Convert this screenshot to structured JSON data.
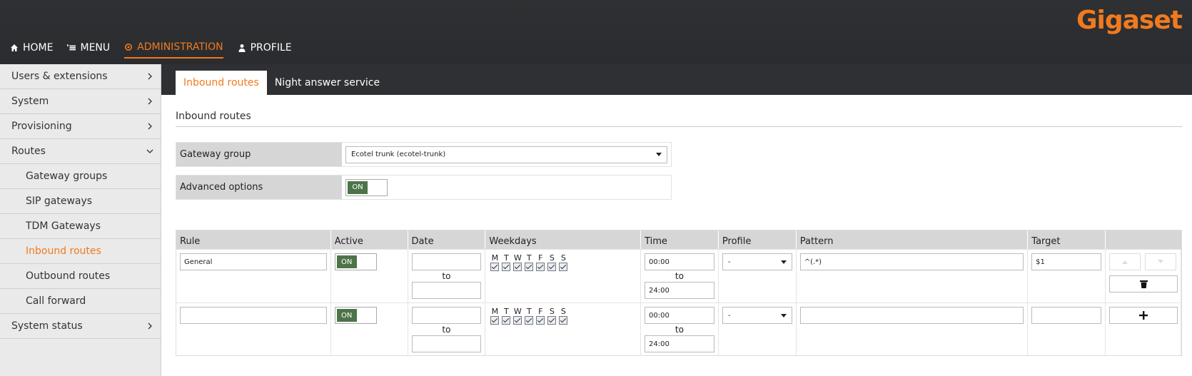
{
  "brand": {
    "logo": "Gigaset",
    "accent": "#f07a1f"
  },
  "topnav": [
    {
      "label": "HOME",
      "icon": "home-icon"
    },
    {
      "label": "MENU",
      "icon": "menu-icon"
    },
    {
      "label": "ADMINISTRATION",
      "icon": "gear-icon",
      "active": true
    },
    {
      "label": "PROFILE",
      "icon": "user-icon"
    }
  ],
  "sidebar": {
    "items": [
      {
        "label": "Users & extensions"
      },
      {
        "label": "System"
      },
      {
        "label": "Provisioning"
      },
      {
        "label": "Routes"
      },
      {
        "label": "Gateway groups"
      },
      {
        "label": "SIP gateways"
      },
      {
        "label": "TDM Gateways"
      },
      {
        "label": "Inbound routes"
      },
      {
        "label": "Outbound routes"
      },
      {
        "label": "Call forward"
      },
      {
        "label": "System status"
      }
    ]
  },
  "tabs": [
    {
      "label": "Inbound routes",
      "active": true
    },
    {
      "label": "Night answer service"
    }
  ],
  "section": {
    "title": "Inbound routes"
  },
  "form": {
    "gateway_group_label": "Gateway group",
    "gateway_group_value": "Ecotel trunk (ecotel-trunk)",
    "advanced_label": "Advanced options",
    "advanced_value": "ON"
  },
  "table": {
    "headers": [
      "Rule",
      "Active",
      "Date",
      "Weekdays",
      "Time",
      "Profile",
      "Pattern",
      "Target"
    ],
    "weekday_letters": [
      "M",
      "T",
      "W",
      "T",
      "F",
      "S",
      "S"
    ],
    "to_label": "to",
    "rows": [
      {
        "rule": "General",
        "active": "ON",
        "date_from": "",
        "date_to": "",
        "time_from": "00:00",
        "time_to": "24:00",
        "profile": "-",
        "pattern": "^(.*)",
        "target": "$1"
      },
      {
        "rule": "",
        "active": "ON",
        "date_from": "",
        "date_to": "",
        "time_from": "00:00",
        "time_to": "24:00",
        "profile": "-",
        "pattern": "",
        "target": ""
      }
    ]
  }
}
